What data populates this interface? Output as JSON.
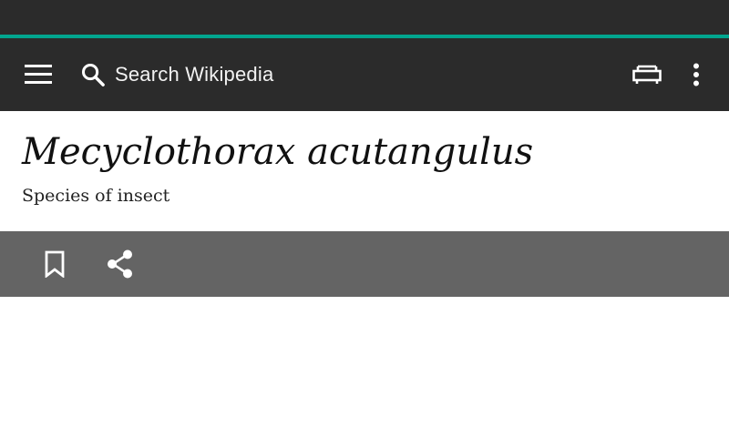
{
  "colors": {
    "status_bar": "#2b2b2b",
    "accent": "#00a68f",
    "toolbar": "#2b2b2b",
    "action_bar": "#646464"
  },
  "toolbar": {
    "search_placeholder": "Search Wikipedia",
    "icons": {
      "menu": "hamburger-menu-icon",
      "search": "search-icon",
      "reading_lists": "reading-lists-icon",
      "overflow": "more-vert-icon"
    }
  },
  "article": {
    "title": "Mecyclothorax acutangulus",
    "description": "Species of insect"
  },
  "actions": {
    "icons": {
      "bookmark": "bookmark-icon",
      "share": "share-icon"
    }
  }
}
